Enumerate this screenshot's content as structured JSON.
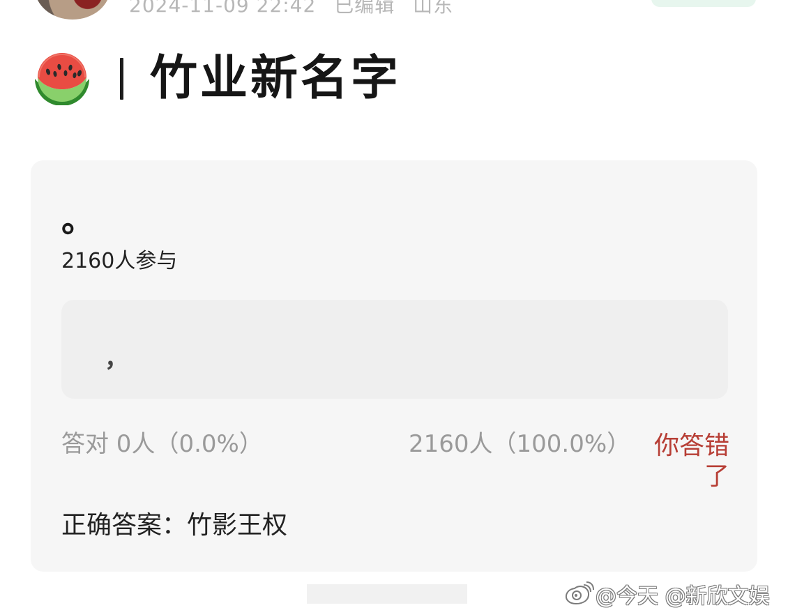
{
  "header": {
    "meta_text": "2024-11-09 22:42",
    "edited_text": "已编辑",
    "location_text": "山东"
  },
  "title": {
    "text": "竹业新名字"
  },
  "quiz": {
    "question": "。",
    "participants": "2160人参与",
    "option_text": "，",
    "stats_left": "答对  0人（0.0%）",
    "stats_right": "2160人（100.0%）",
    "wrong_text": "你答错了",
    "correct_answer": "正确答案：竹影王权"
  },
  "watermark": {
    "text": "@今天 @新欣文娱"
  },
  "icons": {
    "avatar": "avatar",
    "watermelon": "watermelon-icon",
    "weibo": "weibo-icon"
  },
  "colors": {
    "page_bg": "#ffffff",
    "card_bg": "#f6f6f6",
    "option_bg": "#efefef",
    "text_primary": "#1f1f1f",
    "text_muted": "#9a9a9a",
    "wrong_red": "#b73e35"
  }
}
